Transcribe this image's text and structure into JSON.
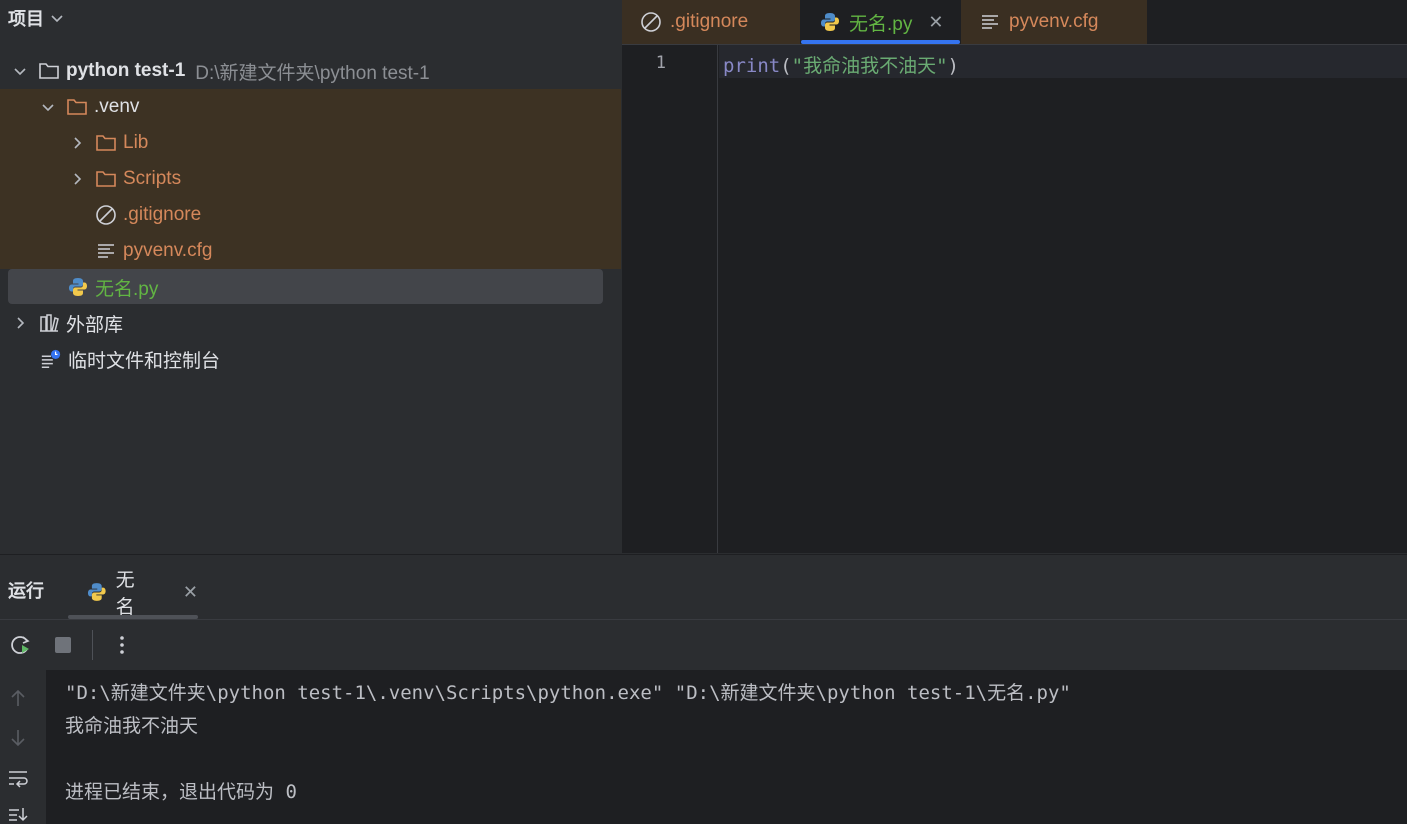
{
  "project": {
    "header_label": "项目",
    "root": {
      "name": "python test-1",
      "path": "D:\\新建文件夹\\python test-1"
    },
    "venv": ".venv",
    "lib": "Lib",
    "scripts": "Scripts",
    "gitignore": ".gitignore",
    "pyvenv": "pyvenv.cfg",
    "main_file": "无名.py",
    "external_libs": "外部库",
    "scratches": "临时文件和控制台"
  },
  "editor": {
    "tabs": [
      {
        "label": ".gitignore"
      },
      {
        "label": "无名.py"
      },
      {
        "label": "pyvenv.cfg"
      }
    ],
    "line_number": "1",
    "code": {
      "keyword": "print",
      "open": "(",
      "string": "\"我命油我不油天\"",
      "close": ")"
    }
  },
  "run": {
    "title": "运行",
    "tab_label": "无名",
    "console": {
      "command": "\"D:\\新建文件夹\\python test-1\\.venv\\Scripts\\python.exe\" \"D:\\新建文件夹\\python test-1\\无名.py\"",
      "output": "我命油我不油天",
      "exit": "进程已结束，退出代码为 0"
    }
  },
  "colors": {
    "excluded": "#d5885b",
    "python_green": "#62b543",
    "accent": "#3574f0",
    "venv_bg": "#3d3223"
  }
}
